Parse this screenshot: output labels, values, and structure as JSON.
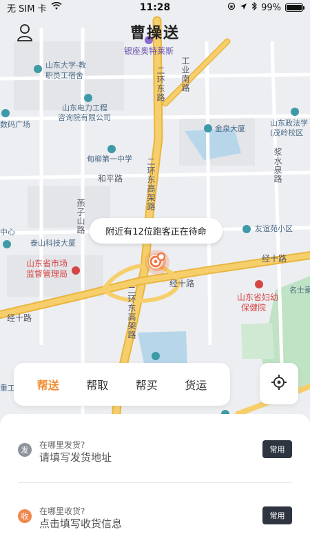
{
  "status_bar": {
    "carrier": "无 SIM 卡",
    "time": "11:28",
    "battery_text": "99%",
    "battery_level": 0.99
  },
  "header": {
    "title": "曹操送"
  },
  "map": {
    "labels": {
      "yinzuo": "银座奥特莱斯",
      "sdu_line1": "山东大学-教",
      "sdu_line2": "职员工宿舍",
      "dianli_line1": "山东电力工程",
      "dianli_line2": "咨询院有限公司",
      "shuma": "数码广场",
      "jinquan": "金泉大厦",
      "zhengfa_line1": "山东政法学",
      "zhengfa_line2": "(茂岭校区",
      "dianliu": "甸柳第一中学",
      "heping": "和平路",
      "yanzi": "燕子山路",
      "zhongxin": "中心",
      "taishan": "泰山科技大厦",
      "youyi": "友谊苑小区",
      "shichang_line1": "山东省市场",
      "shichang_line2": "监督管理局",
      "jingshi_a": "经十路",
      "jingshi_b": "经十路",
      "jingshi_c": "经十路",
      "fuyou_line1": "山东省妇幼",
      "fuyou_line2": "保健院",
      "mingshi": "名士豪",
      "erhuan_a": "二环东路",
      "erhuan_b": "二环东高架路",
      "erhuan_c": "二环东高架路",
      "gongye": "工业南路",
      "jiangshui": "浆水泉路",
      "dongzhuang": "重工"
    }
  },
  "nearby_tip": "附近有12位跑客正在待命",
  "service_tabs": [
    {
      "label": "帮送",
      "active": true
    },
    {
      "label": "帮取",
      "active": false
    },
    {
      "label": "帮买",
      "active": false
    },
    {
      "label": "货运",
      "active": false
    }
  ],
  "order": {
    "send": {
      "badge": "发",
      "hint": "在哪里发货?",
      "placeholder": "请填写发货地址",
      "common_label": "常用"
    },
    "receive": {
      "badge": "收",
      "hint": "在哪里收货?",
      "placeholder": "点击填写收货信息",
      "common_label": "常用"
    }
  },
  "colors": {
    "accent": "#f08c2e",
    "pin": "#f07a4a",
    "highway": "#f2c14e",
    "park": "#bfe3c4",
    "water": "#b7d6ea"
  }
}
